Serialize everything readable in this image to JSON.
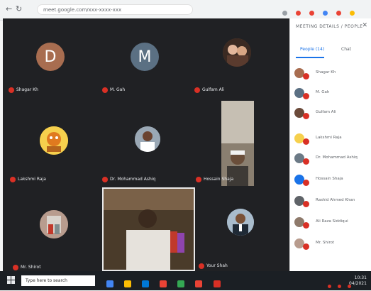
{
  "browser": {
    "url": "meet.google.com/xxx-xxxx-xxx"
  },
  "meeting": {
    "tiles": [
      {
        "name": "Shagar Kh",
        "initial": "D"
      },
      {
        "name": "M. Gah",
        "initial": "M"
      },
      {
        "name": "Gulfam Ali",
        "initial": ""
      },
      {
        "name": "Lakshmi Raja",
        "initial": ""
      },
      {
        "name": "Dr. Mohammad Ashiq",
        "initial": ""
      },
      {
        "name": "Hossain Shaja",
        "initial": ""
      },
      {
        "name": "Mr. Shirot",
        "initial": ""
      },
      {
        "name": "Your Shah",
        "initial": ""
      }
    ]
  },
  "sidebar": {
    "title": "MEETING DETAILS / PEOPLE",
    "tabs": [
      "People (14)",
      "Chat"
    ],
    "people": [
      {
        "name": "Shagar Kh"
      },
      {
        "name": "M. Gah"
      },
      {
        "name": "Gulfam Ali"
      },
      {
        "name": "Lakshmi Raja"
      },
      {
        "name": "Dr. Mohammad Ashiq"
      },
      {
        "name": "Hossain Shaja"
      },
      {
        "name": "Rashid Ahmed Khan"
      },
      {
        "name": "Ali Raza Siddiqui"
      },
      {
        "name": "Mr. Shirot"
      }
    ]
  },
  "taskbar": {
    "search_placeholder": "Type here to search",
    "time": "10:31",
    "date": "04/2021"
  },
  "colors": {
    "grid_bg": "#202124",
    "mic_muted": "#d93025",
    "accent": "#1a73e8"
  }
}
